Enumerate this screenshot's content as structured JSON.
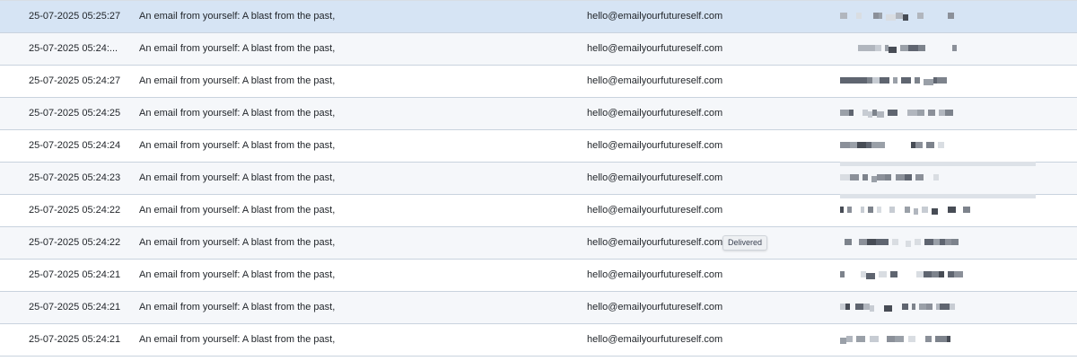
{
  "rows": [
    {
      "date": "25-07-2025 05:25:27",
      "subject": "An email from yourself: A blast from the past,",
      "from": "hello@emailyourfutureself.com",
      "selected": true
    },
    {
      "date": "25-07-2025 05:24:...",
      "subject": "An email from yourself: A blast from the past,",
      "from": "hello@emailyourfutureself.com"
    },
    {
      "date": "25-07-2025 05:24:27",
      "subject": "An email from yourself: A blast from the past,",
      "from": "hello@emailyourfutureself.com"
    },
    {
      "date": "25-07-2025 05:24:25",
      "subject": "An email from yourself: A blast from the past,",
      "from": "hello@emailyourfutureself.com"
    },
    {
      "date": "25-07-2025 05:24:24",
      "subject": "An email from yourself: A blast from the past,",
      "from": "hello@emailyourfutureself.com"
    },
    {
      "date": "25-07-2025 05:24:23",
      "subject": "An email from yourself: A blast from the past,",
      "from": "hello@emailyourfutureself.com"
    },
    {
      "date": "25-07-2025 05:24:22",
      "subject": "An email from yourself: A blast from the past,",
      "from": "hello@emailyourfutureself.com"
    },
    {
      "date": "25-07-2025 05:24:22",
      "subject": "An email from yourself: A blast from the past,",
      "from": "hello@emailyourfutureself.com",
      "status": "Delivered"
    },
    {
      "date": "25-07-2025 05:24:21",
      "subject": "An email from yourself: A blast from the past,",
      "from": "hello@emailyourfutureself.com"
    },
    {
      "date": "25-07-2025 05:24:21",
      "subject": "An email from yourself: A blast from the past,",
      "from": "hello@emailyourfutureself.com"
    },
    {
      "date": "25-07-2025 05:24:21",
      "subject": "An email from yourself: A blast from the past,",
      "from": "hello@emailyourfutureself.com"
    }
  ],
  "colors": {
    "selected_row": "#d6e4f4",
    "alt_row": "#f5f7fa",
    "row_border": "#c9d3de"
  }
}
